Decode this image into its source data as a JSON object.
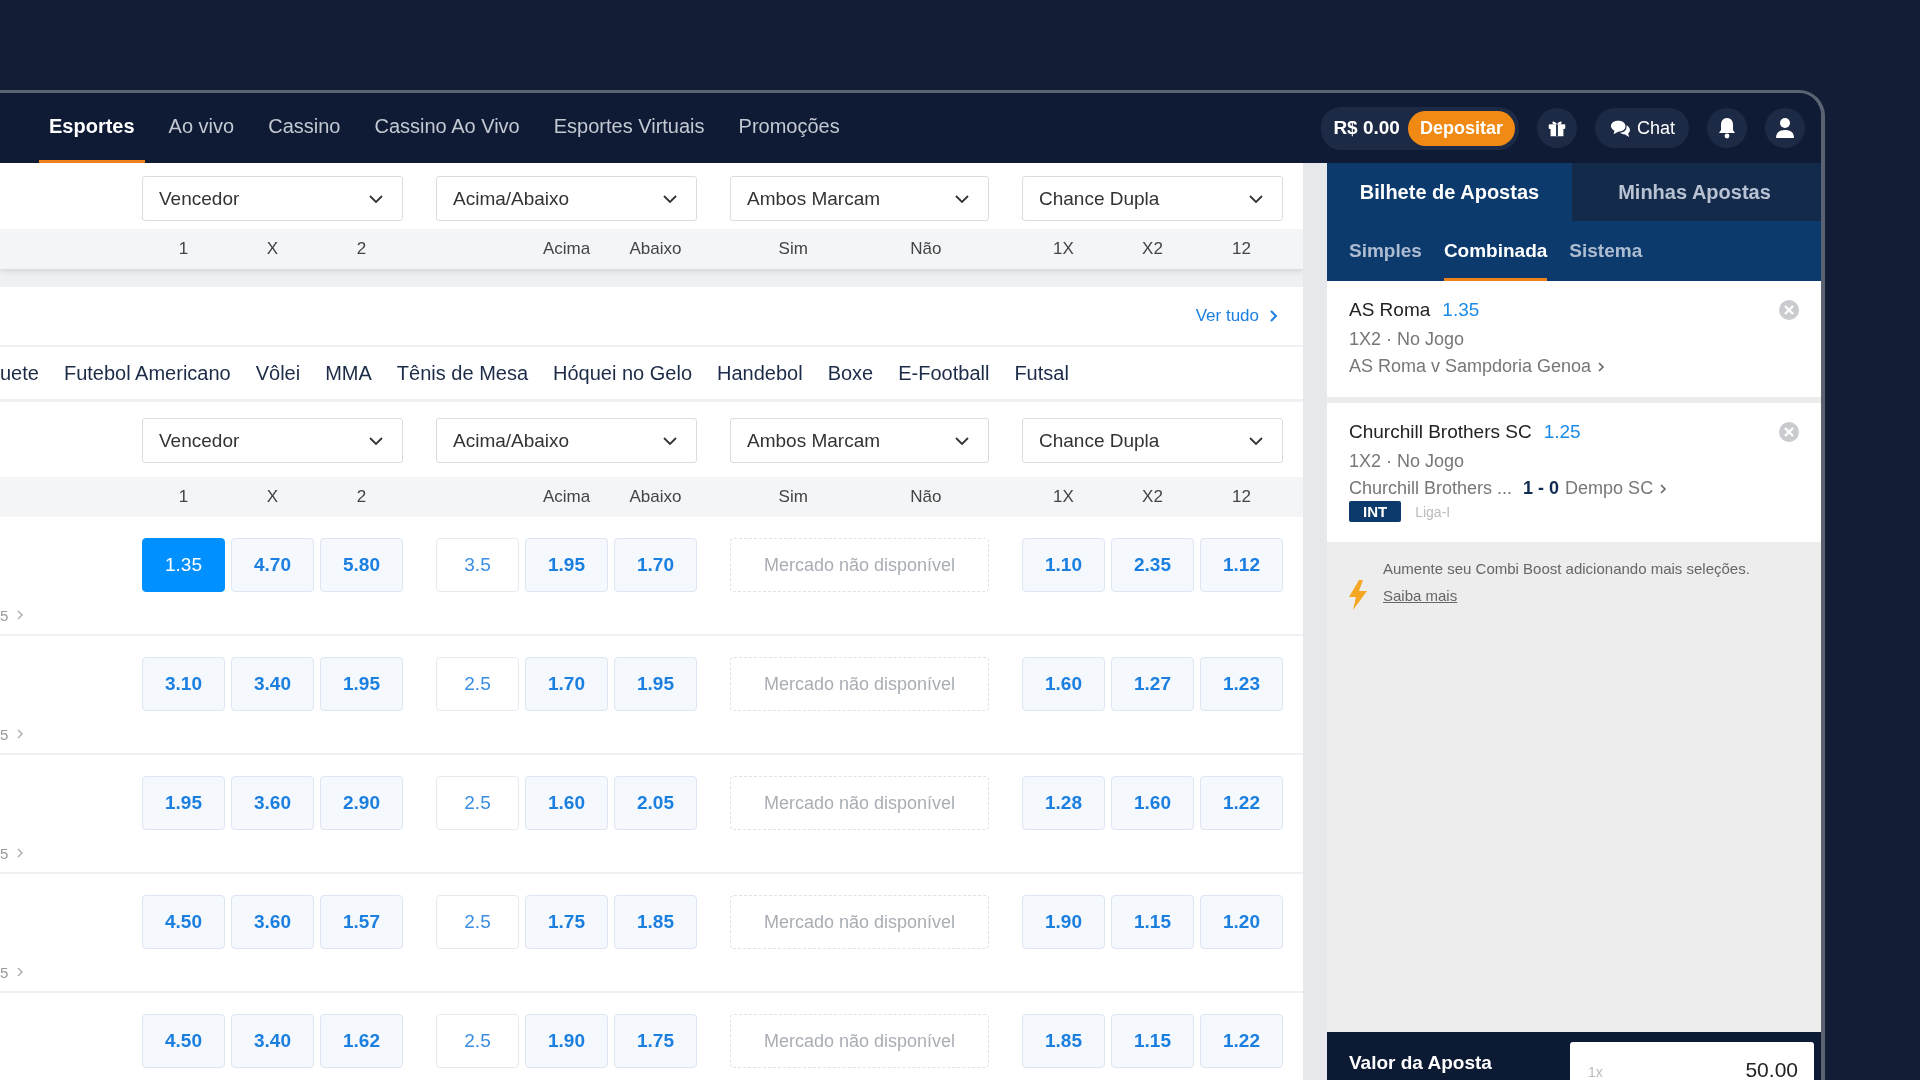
{
  "nav": {
    "items": [
      {
        "label": "Esportes",
        "selected": true
      },
      {
        "label": "Ao vivo",
        "selected": false
      },
      {
        "label": "Cassino",
        "selected": false
      },
      {
        "label": "Cassino Ao Vivo",
        "selected": false
      },
      {
        "label": "Esportes Virtuais",
        "selected": false
      },
      {
        "label": "Promoções",
        "selected": false
      }
    ],
    "balance": "R$ 0.00",
    "deposit": "Depositar",
    "chat": "Chat"
  },
  "header_markets": {
    "dropdowns": [
      "Vencedor",
      "Acima/Abaixo",
      "Ambos Marcam",
      "Chance Dupla"
    ],
    "columns": [
      {
        "kind": "triple",
        "labels": [
          "1",
          "X",
          "2"
        ]
      },
      {
        "kind": "line",
        "labels": [
          "Acima",
          "Abaixo"
        ]
      },
      {
        "kind": "pair",
        "labels": [
          "Sim",
          "Não"
        ]
      },
      {
        "kind": "triple",
        "labels": [
          "1X",
          "X2",
          "12"
        ]
      }
    ]
  },
  "section": {
    "ver_tudo": "Ver tudo",
    "sports": [
      "uete",
      "Futebol Americano",
      "Vôlei",
      "MMA",
      "Tênis de Mesa",
      "Hóquei no Gelo",
      "Handebol",
      "Boxe",
      "E-Football",
      "Futsal"
    ],
    "dropdowns": [
      "Vencedor",
      "Acima/Abaixo",
      "Ambos Marcam",
      "Chance Dupla"
    ],
    "columns": [
      {
        "kind": "triple",
        "labels": [
          "1",
          "X",
          "2"
        ]
      },
      {
        "kind": "line",
        "labels": [
          "Acima",
          "Abaixo"
        ]
      },
      {
        "kind": "pair",
        "labels": [
          "Sim",
          "Não"
        ]
      },
      {
        "kind": "triple",
        "labels": [
          "1X",
          "X2",
          "12"
        ]
      }
    ],
    "rows": [
      {
        "footer": "5",
        "groups": [
          {
            "kind": "odds",
            "odds": [
              {
                "value": "1.35",
                "selected": true
              },
              {
                "value": "4.70",
                "selected": false
              },
              {
                "value": "5.80",
                "selected": false
              }
            ]
          },
          {
            "kind": "line",
            "line": "3.5",
            "odds": [
              {
                "value": "1.95",
                "selected": false
              },
              {
                "value": "1.70",
                "selected": false
              }
            ]
          },
          {
            "kind": "unavailable",
            "text": "Mercado não disponível"
          },
          {
            "kind": "odds",
            "odds": [
              {
                "value": "1.10",
                "selected": false
              },
              {
                "value": "2.35",
                "selected": false
              },
              {
                "value": "1.12",
                "selected": false
              }
            ]
          }
        ]
      },
      {
        "footer": "5",
        "groups": [
          {
            "kind": "odds",
            "odds": [
              {
                "value": "3.10",
                "selected": false
              },
              {
                "value": "3.40",
                "selected": false
              },
              {
                "value": "1.95",
                "selected": false
              }
            ]
          },
          {
            "kind": "line",
            "line": "2.5",
            "odds": [
              {
                "value": "1.70",
                "selected": false
              },
              {
                "value": "1.95",
                "selected": false
              }
            ]
          },
          {
            "kind": "unavailable",
            "text": "Mercado não disponível"
          },
          {
            "kind": "odds",
            "odds": [
              {
                "value": "1.60",
                "selected": false
              },
              {
                "value": "1.27",
                "selected": false
              },
              {
                "value": "1.23",
                "selected": false
              }
            ]
          }
        ]
      },
      {
        "footer": "5",
        "groups": [
          {
            "kind": "odds",
            "odds": [
              {
                "value": "1.95",
                "selected": false
              },
              {
                "value": "3.60",
                "selected": false
              },
              {
                "value": "2.90",
                "selected": false
              }
            ]
          },
          {
            "kind": "line",
            "line": "2.5",
            "odds": [
              {
                "value": "1.60",
                "selected": false
              },
              {
                "value": "2.05",
                "selected": false
              }
            ]
          },
          {
            "kind": "unavailable",
            "text": "Mercado não disponível"
          },
          {
            "kind": "odds",
            "odds": [
              {
                "value": "1.28",
                "selected": false
              },
              {
                "value": "1.60",
                "selected": false
              },
              {
                "value": "1.22",
                "selected": false
              }
            ]
          }
        ]
      },
      {
        "footer": "5",
        "groups": [
          {
            "kind": "odds",
            "odds": [
              {
                "value": "4.50",
                "selected": false
              },
              {
                "value": "3.60",
                "selected": false
              },
              {
                "value": "1.57",
                "selected": false
              }
            ]
          },
          {
            "kind": "line",
            "line": "2.5",
            "odds": [
              {
                "value": "1.75",
                "selected": false
              },
              {
                "value": "1.85",
                "selected": false
              }
            ]
          },
          {
            "kind": "unavailable",
            "text": "Mercado não disponível"
          },
          {
            "kind": "odds",
            "odds": [
              {
                "value": "1.90",
                "selected": false
              },
              {
                "value": "1.15",
                "selected": false
              },
              {
                "value": "1.20",
                "selected": false
              }
            ]
          }
        ]
      },
      {
        "groups": [
          {
            "kind": "odds",
            "odds": [
              {
                "value": "4.50",
                "selected": false
              },
              {
                "value": "3.40",
                "selected": false
              },
              {
                "value": "1.62",
                "selected": false
              }
            ]
          },
          {
            "kind": "line",
            "line": "2.5",
            "odds": [
              {
                "value": "1.90",
                "selected": false
              },
              {
                "value": "1.75",
                "selected": false
              }
            ]
          },
          {
            "kind": "unavailable",
            "text": "Mercado não disponível"
          },
          {
            "kind": "odds",
            "odds": [
              {
                "value": "1.85",
                "selected": false
              },
              {
                "value": "1.15",
                "selected": false
              },
              {
                "value": "1.22",
                "selected": false
              }
            ]
          }
        ]
      }
    ]
  },
  "betslip": {
    "tabs": [
      {
        "label": "Bilhete de Apostas",
        "selected": true
      },
      {
        "label": "Minhas Apostas",
        "selected": false
      }
    ],
    "subtabs": [
      {
        "label": "Simples",
        "selected": false
      },
      {
        "label": "Combinada",
        "selected": true
      },
      {
        "label": "Sistema",
        "selected": false
      }
    ],
    "bets": [
      {
        "kind": "plain",
        "team": "AS Roma",
        "odd": "1.35",
        "market": "1X2 · No Jogo",
        "event": "AS Roma v Sampdoria Genoa"
      },
      {
        "kind": "live",
        "team": "Churchill Brothers SC",
        "odd": "1.25",
        "market": "1X2 · No Jogo",
        "home": "Churchill Brothers ...",
        "score_home": "1",
        "score_sep": "-",
        "score_away": "0",
        "away": "Dempo SC",
        "badge": "INT",
        "league": "Liga-I"
      }
    ],
    "boost": {
      "text": "Aumente seu Combi Boost adicionando mais seleções.",
      "link": "Saiba mais"
    },
    "stake": {
      "label": "Valor da Aposta",
      "multiplier": "1x",
      "value": "50.00"
    }
  }
}
